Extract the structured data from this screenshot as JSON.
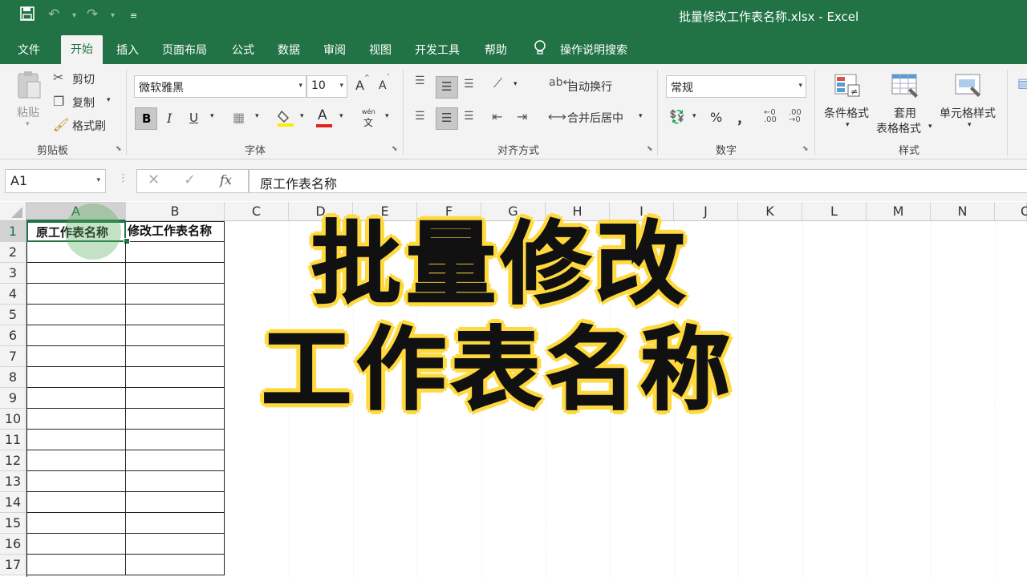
{
  "window": {
    "title": "批量修改工作表名称.xlsx  -  Excel"
  },
  "quick_access": {
    "save_icon": "save-icon",
    "undo_icon": "undo-icon",
    "redo_icon": "redo-icon",
    "customize_icon": "customize-icon"
  },
  "tabs": [
    {
      "label": "文件"
    },
    {
      "label": "开始"
    },
    {
      "label": "插入"
    },
    {
      "label": "页面布局"
    },
    {
      "label": "公式"
    },
    {
      "label": "数据"
    },
    {
      "label": "审阅"
    },
    {
      "label": "视图"
    },
    {
      "label": "开发工具"
    },
    {
      "label": "帮助"
    }
  ],
  "tell_me": "操作说明搜索",
  "ribbon": {
    "clipboard": {
      "paste": "粘贴",
      "cut": "剪切",
      "copy": "复制",
      "format_painter": "格式刷",
      "group": "剪贴板"
    },
    "font": {
      "name": "微软雅黑",
      "size": "10",
      "bold": "B",
      "italic": "I",
      "underline": "U",
      "grow": "A",
      "shrink": "A",
      "font_color": "A",
      "phonetic": "文",
      "phonetic_top": "wén",
      "group": "字体"
    },
    "alignment": {
      "wrap": "自动换行",
      "merge": "合并后居中",
      "group": "对齐方式"
    },
    "number": {
      "format": "常规",
      "percent": "%",
      "comma": "，",
      "group": "数字"
    },
    "styles": {
      "conditional": "条件格式",
      "table1": "套用",
      "table2": "表格格式",
      "cell_styles": "单元格样式",
      "group": "样式"
    }
  },
  "formula_bar": {
    "name_box": "A1",
    "fx": "fx",
    "content": "原工作表名称"
  },
  "columns": [
    "A",
    "B",
    "C",
    "D",
    "E",
    "F",
    "G",
    "H",
    "I",
    "J",
    "K",
    "L",
    "M",
    "N",
    "O"
  ],
  "rows": [
    "1",
    "2",
    "3",
    "4",
    "5",
    "6",
    "7",
    "8",
    "9",
    "10",
    "11",
    "12",
    "13",
    "14",
    "15",
    "16",
    "17"
  ],
  "cells": {
    "A1": "原工作表名称",
    "B1": "修改工作表名称"
  },
  "overlay": {
    "line1": "批量修改",
    "line2": "工作表名称"
  }
}
